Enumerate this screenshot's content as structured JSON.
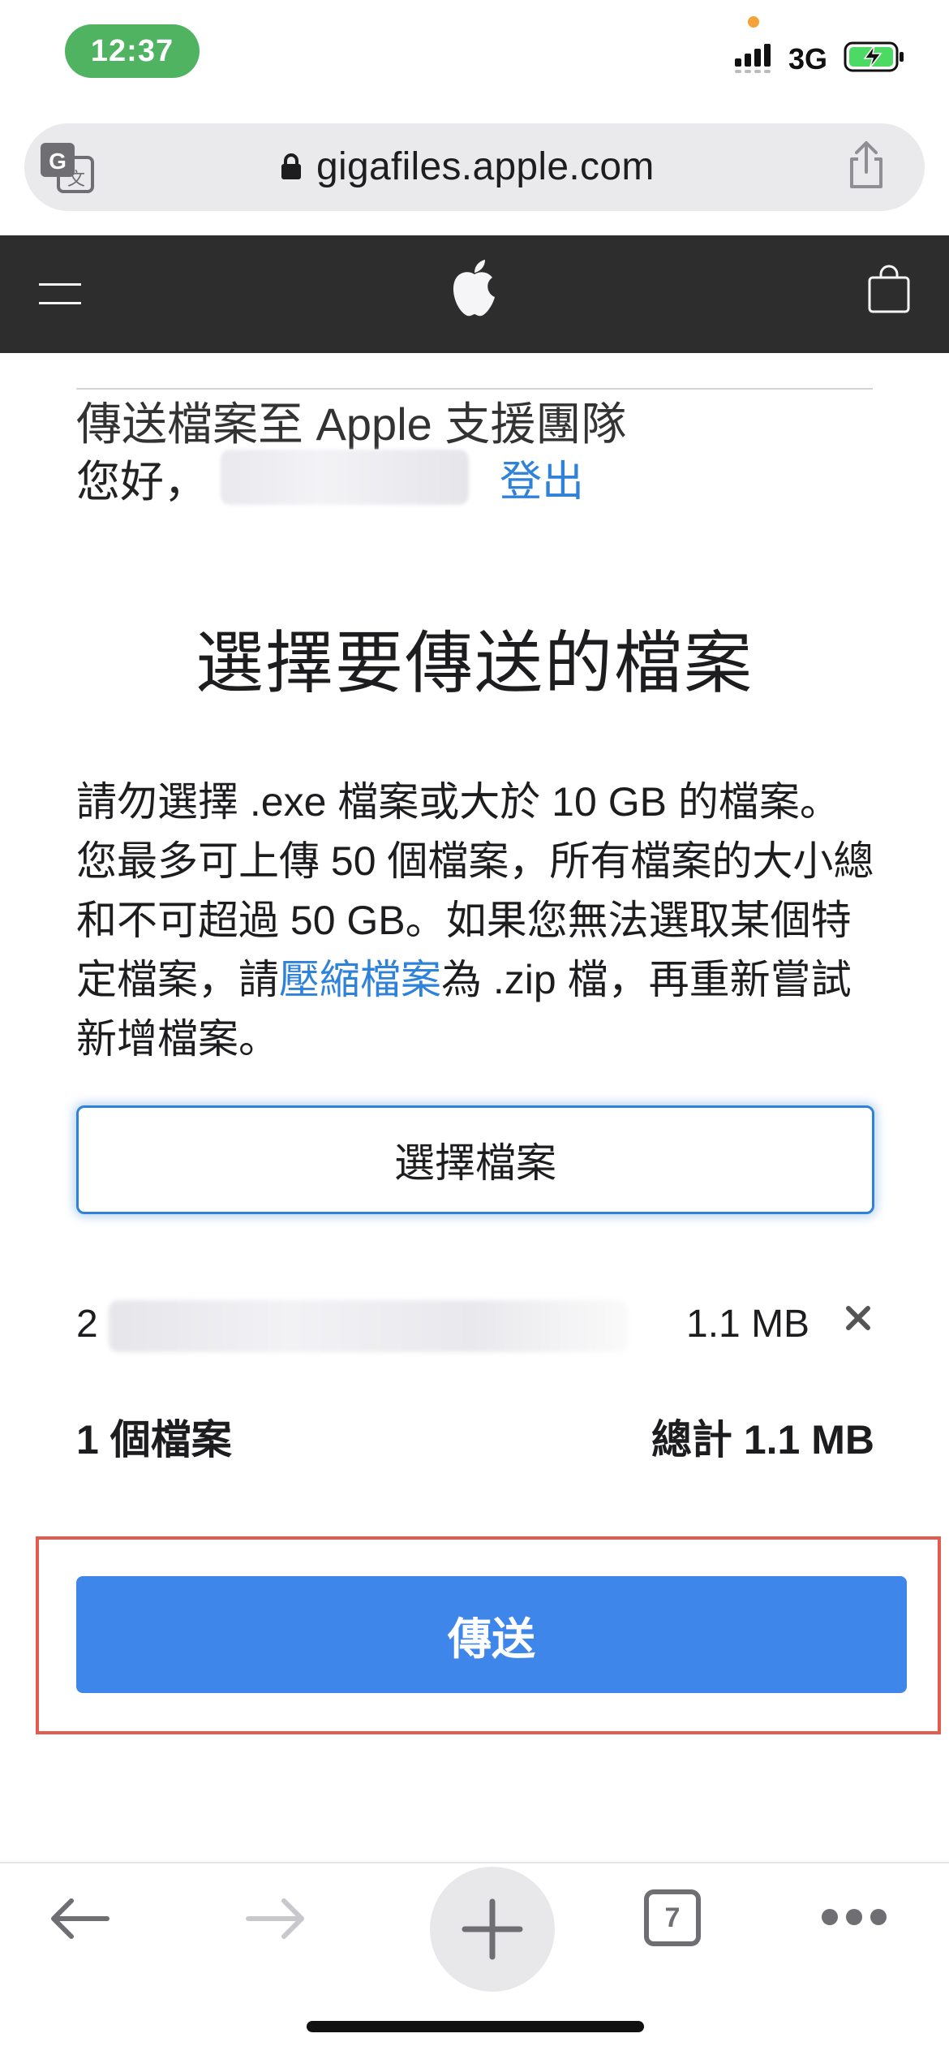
{
  "status_bar": {
    "time": "12:37",
    "network": "3G",
    "colors": {
      "time_pill": "#4fb362",
      "battery": "#4cd964",
      "privacy_dot": "#f3a33a"
    }
  },
  "address_bar": {
    "url": "gigafiles.apple.com",
    "icons": [
      "translate-icon",
      "lock-icon",
      "share-icon"
    ]
  },
  "nav": {
    "background": "#2d2d2d",
    "icons": [
      "menu-icon",
      "apple-logo-icon",
      "shopping-bag-icon"
    ]
  },
  "page": {
    "header": "傳送檔案至 Apple 支援團隊",
    "greeting": "您好，",
    "sign_out": "登出",
    "section_title": "選擇要傳送的檔案",
    "instructions_before_link": "請勿選擇 .exe 檔案或大於 10 GB 的檔案。您最多可上傳 50 個檔案，所有檔案的大小總和不可超過 50 GB。如果您無法選取某個特定檔案，請",
    "instructions_link": "壓縮檔案",
    "instructions_after_link": "為 .zip 檔，再重新嘗試新增檔案。",
    "choose_button": "選擇檔案",
    "files": [
      {
        "name_prefix": "2",
        "size": "1.1 MB"
      }
    ],
    "file_count": "1 個檔案",
    "total": "總計 1.1 MB",
    "send_button": "傳送",
    "accent_color": "#2f82d9",
    "send_color": "#3f86ea",
    "highlight_color": "#e35b4f"
  },
  "toolbar": {
    "tab_count": "7",
    "icons": [
      "back-arrow-icon",
      "forward-arrow-icon",
      "plus-icon",
      "tabs-icon",
      "more-icon"
    ]
  }
}
